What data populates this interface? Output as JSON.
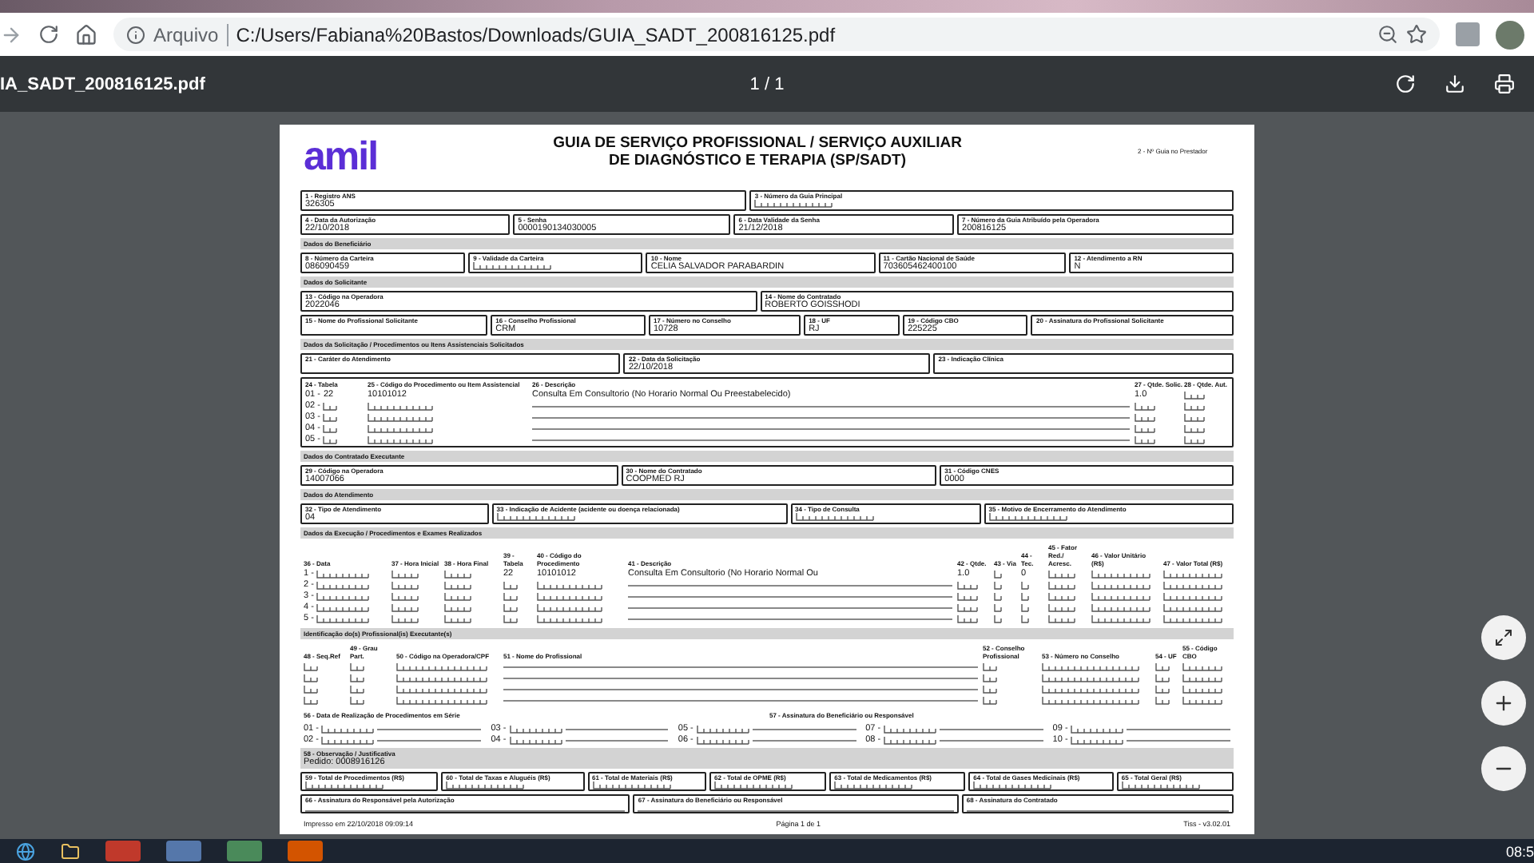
{
  "browser": {
    "address_prefix": "Arquivo",
    "url": "C:/Users/Fabiana%20Bastos/Downloads/GUIA_SADT_200816125.pdf"
  },
  "viewer": {
    "file_name": "IA_SADT_200816125.pdf",
    "page_count": "1 / 1"
  },
  "form": {
    "brand": "amil",
    "title": [
      "GUIA DE SERVIÇO PROFISSIONAL / SERVIÇO AUXILIAR",
      "DE DIAGNÓSTICO E TERAPIA (SP/SADT)"
    ],
    "guide_number_label": "2 - Nº Guia no Prestador",
    "blocks": [
      {
        "kind": "fields",
        "fields": [
          {
            "label": "1 - Registro ANS",
            "value": "326305"
          },
          {
            "label": "3 - Número da Guia Principal",
            "boxes": true
          }
        ]
      },
      {
        "kind": "fields",
        "fields": [
          {
            "label": "4 - Data da Autorização",
            "value": "22/10/2018"
          },
          {
            "label": "5 - Senha",
            "value": "0000190134030005"
          },
          {
            "label": "6 - Data Validade da Senha",
            "value": "21/12/2018"
          },
          {
            "label": "7 - Número da Guia Atribuído pela Operadora",
            "value": "200816125"
          }
        ]
      },
      {
        "kind": "heading",
        "text": "Dados do Beneficiário"
      },
      {
        "kind": "fields",
        "fields": [
          {
            "label": "8 - Número da Carteira",
            "value": "086090459"
          },
          {
            "label": "9 - Validade da Carteira",
            "boxes": true
          },
          {
            "label": "10 - Nome",
            "value": "CELIA SALVADOR PARABARDIN"
          },
          {
            "label": "11 - Cartão Nacional de Saúde",
            "value": "703605462400100"
          },
          {
            "label": "12 - Atendimento a RN",
            "value": "N"
          }
        ]
      },
      {
        "kind": "heading",
        "text": "Dados do Solicitante"
      },
      {
        "kind": "fields",
        "fields": [
          {
            "label": "13 - Código na Operadora",
            "value": "2022046"
          },
          {
            "label": "14 - Nome do Contratado",
            "value": "ROBERTO GOISSHODI"
          }
        ]
      },
      {
        "kind": "fields",
        "fields": [
          {
            "label": "15 - Nome do Profissional Solicitante"
          },
          {
            "label": "16 - Conselho Profissional",
            "value": "CRM"
          },
          {
            "label": "17 - Número no Conselho",
            "value": "10728"
          },
          {
            "label": "18 - UF",
            "value": "RJ"
          },
          {
            "label": "19 - Código CBO",
            "value": "225225"
          },
          {
            "label": "20 - Assinatura do Profissional Solicitante"
          }
        ]
      },
      {
        "kind": "heading",
        "text": "Dados da Solicitação / Procedimentos ou Itens Assistenciais Solicitados"
      },
      {
        "kind": "fields",
        "fields": [
          {
            "label": "21 - Caráter do Atendimento"
          },
          {
            "label": "22 - Data da Solicitação",
            "value": "22/10/2018"
          },
          {
            "label": "23 - Indicação Clínica"
          }
        ]
      },
      {
        "kind": "requested",
        "columns": [
          "24 - Tabela",
          "25 - Código do Procedimento ou Item Assistencial",
          "26 - Descrição",
          "27 - Qtde. Solic.",
          "28 - Qtde. Aut."
        ],
        "rows": [
          {
            "index": "01 -",
            "table": "22",
            "code": "10101012",
            "description": "Consulta Em Consultorio (No Horario Normal Ou Preestabelecido)",
            "quantity": "1.0"
          },
          {
            "index": "02 -"
          },
          {
            "index": "03 -"
          },
          {
            "index": "04 -"
          },
          {
            "index": "05 -"
          }
        ]
      },
      {
        "kind": "heading",
        "text": "Dados do Contratado Executante"
      },
      {
        "kind": "fields",
        "fields": [
          {
            "label": "29 - Código na Operadora",
            "value": "14007066"
          },
          {
            "label": "30 - Nome do Contratado",
            "value": "COOPMED RJ"
          },
          {
            "label": "31 - Código CNES",
            "value": "0000"
          }
        ]
      },
      {
        "kind": "heading",
        "text": "Dados do Atendimento"
      },
      {
        "kind": "fields",
        "fields": [
          {
            "label": "32 - Tipo de Atendimento",
            "value": "04"
          },
          {
            "label": "33 - Indicação de Acidente (acidente ou doença relacionada)",
            "boxes": true
          },
          {
            "label": "34 - Tipo de Consulta",
            "boxes": true
          },
          {
            "label": "35 - Motivo de Encerramento do Atendimento",
            "boxes": true
          }
        ]
      },
      {
        "kind": "heading",
        "text": "Dados da Execução / Procedimentos e Exames Realizados"
      },
      {
        "kind": "executed",
        "columns": [
          "36 - Data",
          "37 - Hora Inicial",
          "38 - Hora Final",
          "39 - Tabela",
          "40 - Código do Procedimento",
          "41 - Descrição",
          "42 - Qtde.",
          "43 - Via",
          "44 - Tec.",
          "45 - Fator Red./ Acresc.",
          "46 - Valor Unitário (R$)",
          "47 - Valor Total (R$)"
        ],
        "rows": [
          {
            "index": "1 -",
            "table": "22",
            "code": "10101012",
            "description": "Consulta Em Consultorio (No Horario Normal Ou",
            "quantity": "1.0",
            "technique": "0"
          },
          {
            "index": "2 -"
          },
          {
            "index": "3 -"
          },
          {
            "index": "4 -"
          },
          {
            "index": "5 -"
          }
        ]
      },
      {
        "kind": "heading",
        "text": "Identificação do(s) Profissional(is) Executante(s)"
      },
      {
        "kind": "professionals",
        "columns": [
          "48 - Seq.Ref",
          "49 - Grau Part.",
          "50 - Código na Operadora/CPF",
          "51 - Nome do Profissional",
          "52 - Conselho Profissional",
          "53 - Número no Conselho",
          "54 - UF",
          "55 - Código CBO"
        ]
      },
      {
        "kind": "serial",
        "labels": [
          "56 - Data de Realização de Procedimentos em Série",
          "57 - Assinatura do Beneficiário ou Responsável"
        ],
        "items": [
          "01 -",
          "02 -",
          "03 -",
          "04 -",
          "05 -",
          "06 -",
          "07 -",
          "08 -",
          "09 -",
          "10 -"
        ]
      },
      {
        "kind": "observation",
        "label": "58 - Observação / Justificativa",
        "text": "Pedido: 0008916126"
      },
      {
        "kind": "fields",
        "fields": [
          {
            "label": "59 - Total de Procedimentos (R$)",
            "boxes": true
          },
          {
            "label": "60 - Total de Taxas e Aluguéis (R$)",
            "boxes": true
          },
          {
            "label": "61 - Total de Materiais (R$)",
            "boxes": true
          },
          {
            "label": "62 - Total de OPME (R$)",
            "boxes": true
          },
          {
            "label": "63 - Total de Medicamentos (R$)",
            "boxes": true
          },
          {
            "label": "64 - Total de Gases Medicinais (R$)",
            "boxes": true
          },
          {
            "label": "65 - Total Geral (R$)",
            "boxes": true
          }
        ]
      },
      {
        "kind": "fields",
        "fields": [
          {
            "label": "66 - Assinatura do Responsável pela Autorização",
            "line": true
          },
          {
            "label": "67 - Assinatura do Beneficiário ou Responsável",
            "line": true
          },
          {
            "label": "68 - Assinatura do Contratado",
            "line": true
          }
        ]
      }
    ],
    "footer": {
      "printed": "Impresso em 22/10/2018 09:09:14",
      "page": "Página 1 de 1",
      "version": "Tiss - v3.02.01"
    }
  },
  "taskbar": {
    "clock": "08:5"
  }
}
